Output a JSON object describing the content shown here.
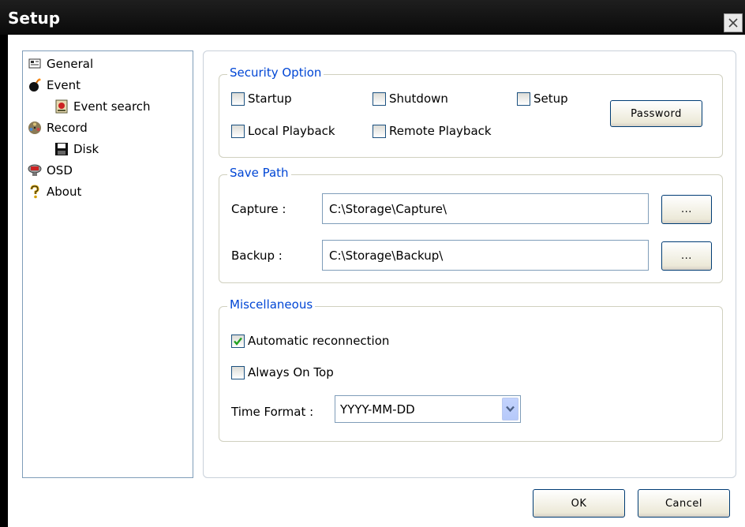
{
  "window": {
    "title": "Setup"
  },
  "sidebar": {
    "items": [
      {
        "label": "General",
        "icon": "general-icon"
      },
      {
        "label": "Event",
        "icon": "bomb-icon"
      },
      {
        "label": "Event search",
        "icon": "event-search-icon"
      },
      {
        "label": "Record",
        "icon": "film-reel-icon"
      },
      {
        "label": "Disk",
        "icon": "floppy-disk-icon"
      },
      {
        "label": "OSD",
        "icon": "monitor-icon"
      },
      {
        "label": "About",
        "icon": "question-icon"
      }
    ]
  },
  "security": {
    "title": "Security Option",
    "startup": {
      "label": "Startup",
      "checked": false
    },
    "shutdown": {
      "label": "Shutdown",
      "checked": false
    },
    "setup": {
      "label": "Setup",
      "checked": false
    },
    "local_playback": {
      "label": "Local Playback",
      "checked": false
    },
    "remote_playback": {
      "label": "Remote Playback",
      "checked": false
    },
    "password_button": "Password"
  },
  "save_path": {
    "title": "Save Path",
    "capture_label": "Capture :",
    "capture_value": "C:\\Storage\\Capture\\",
    "backup_label": "Backup :",
    "backup_value": "C:\\Storage\\Backup\\",
    "browse_label": "..."
  },
  "misc": {
    "title": "Miscellaneous",
    "auto_reconnect": {
      "label": "Automatic reconnection",
      "checked": true
    },
    "always_on_top": {
      "label": "Always On Top",
      "checked": false
    },
    "time_format_label": "Time Format :",
    "time_format_value": "YYYY-MM-DD"
  },
  "footer": {
    "ok": "OK",
    "cancel": "Cancel"
  },
  "colors": {
    "titlebar": "#111111",
    "group_title": "#0046d5",
    "check": "#21a121"
  }
}
